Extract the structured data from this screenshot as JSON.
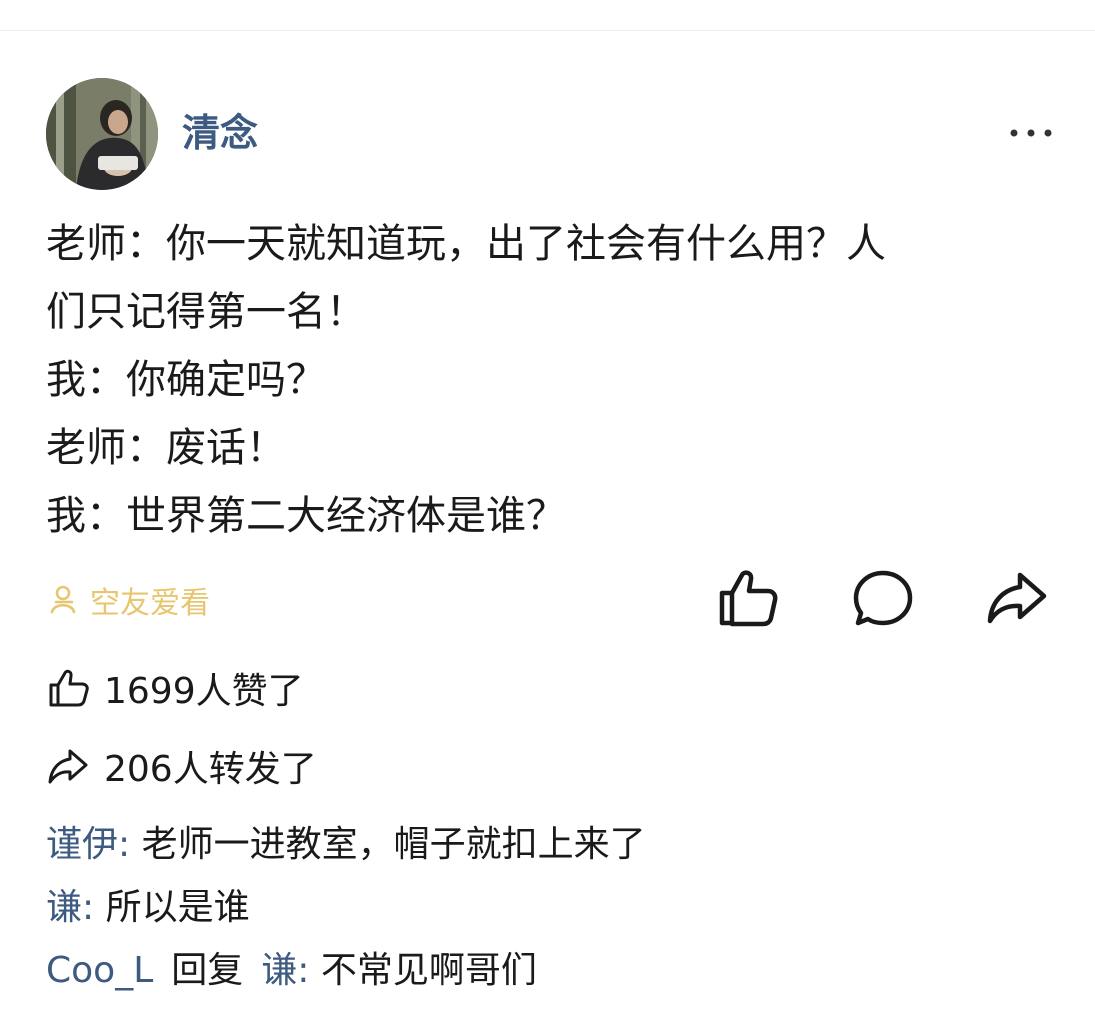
{
  "post": {
    "author": "清念",
    "content_lines": [
      "老师：你一天就知道玩，出了社会有什么用？人",
      "们只记得第一名！",
      "我：你确定吗？",
      "老师：废话！",
      "我：世界第二大经济体是谁？"
    ],
    "visibility_tag": "空友爱看",
    "more_icon": "more-dots-icon",
    "actions": {
      "like_icon": "thumbs-up-icon",
      "comment_icon": "comment-bubble-icon",
      "share_icon": "share-arrow-icon"
    },
    "likes_text": "1699人赞了",
    "shares_text": "206人转发了",
    "colors": {
      "username": "#3d5a80",
      "tag": "#e7c66f",
      "text": "#1a1a1a"
    }
  },
  "comments": [
    {
      "author": "谨伊",
      "separator": ": ",
      "text": "老师一进教室，帽子就扣上来了"
    },
    {
      "author": "谦",
      "separator": ": ",
      "text": "所以是谁"
    },
    {
      "author": "Coo_L",
      "reply_word": "回复",
      "reply_to": "谦",
      "separator": ": ",
      "text": "不常见啊哥们"
    }
  ]
}
